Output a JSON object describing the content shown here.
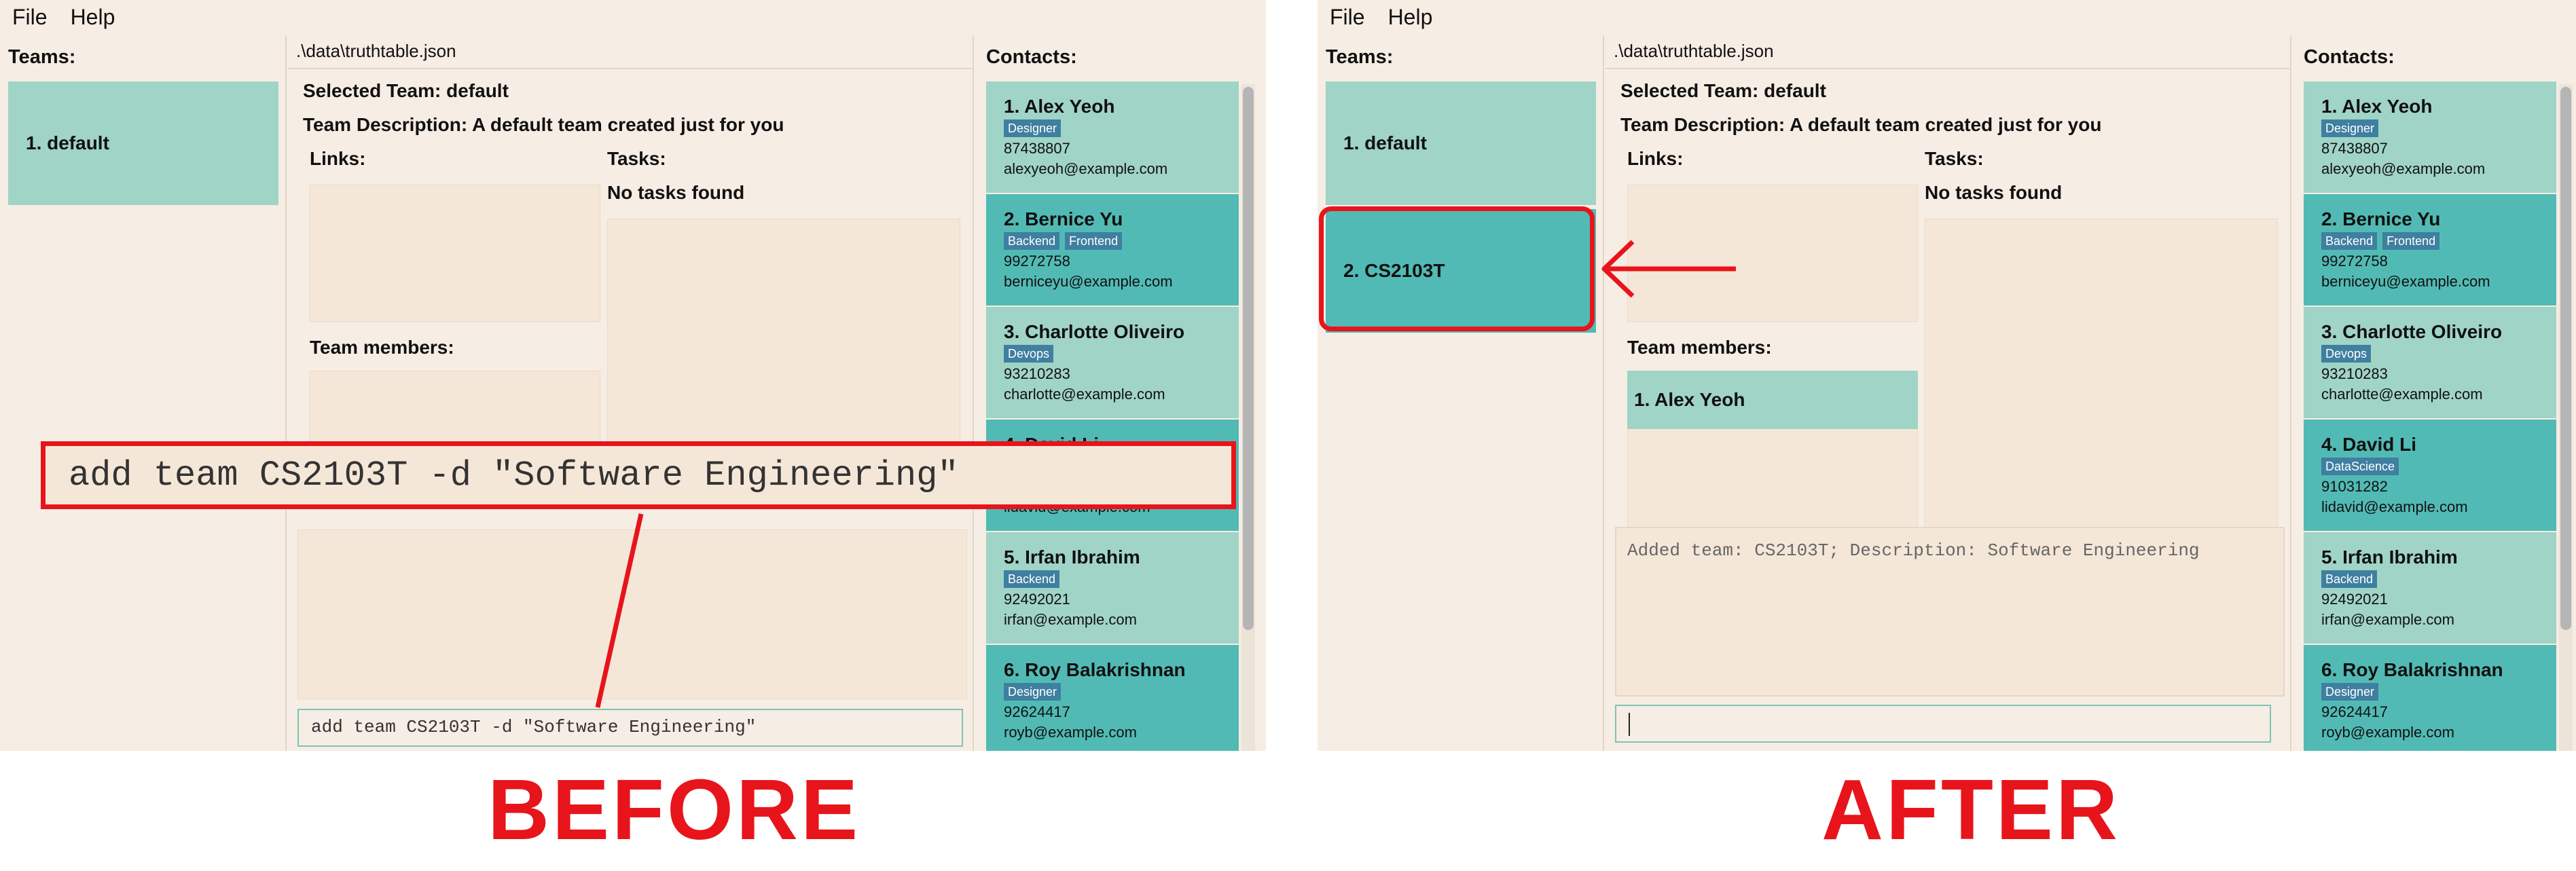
{
  "menu": {
    "file": "File",
    "help": "Help"
  },
  "teams_title": "Teams:",
  "contacts_title": "Contacts:",
  "file_path": ".\\data\\truthtable.json",
  "selected_team": "Selected Team: default",
  "team_description": "Team Description: A default team created just for you",
  "links_label": "Links:",
  "tasks_label": "Tasks:",
  "no_tasks": "No tasks found",
  "team_members_label": "Team members:",
  "before": {
    "teams": [
      "1. default"
    ],
    "command_input": "add team CS2103T -d \"Software Engineering\"",
    "overlay_command": "add team CS2103T -d \"Software Engineering\"",
    "label": "BEFORE"
  },
  "after": {
    "teams": [
      "1. default",
      "2. CS2103T"
    ],
    "member": "1. Alex Yeoh",
    "result": "Added team: CS2103T; Description: Software Engineering",
    "command_input": "",
    "label": "AFTER"
  },
  "contacts": [
    {
      "name": "1. Alex Yeoh",
      "tags": [
        "Designer"
      ],
      "phone": "87438807",
      "email": "alexyeoh@example.com"
    },
    {
      "name": "2. Bernice Yu",
      "tags": [
        "Backend",
        "Frontend"
      ],
      "phone": "99272758",
      "email": "berniceyu@example.com"
    },
    {
      "name": "3. Charlotte Oliveiro",
      "tags": [
        "Devops"
      ],
      "phone": "93210283",
      "email": "charlotte@example.com"
    },
    {
      "name": "4. David Li",
      "tags": [
        "DataScience"
      ],
      "phone": "91031282",
      "email": "lidavid@example.com"
    },
    {
      "name": "5. Irfan Ibrahim",
      "tags": [
        "Backend"
      ],
      "phone": "92492021",
      "email": "irfan@example.com"
    },
    {
      "name": "6. Roy Balakrishnan",
      "tags": [
        "Designer"
      ],
      "phone": "92624417",
      "email": "royb@example.com"
    }
  ],
  "colors": {
    "accent_red": "#e8141b",
    "card_light": "#a0d4c6",
    "card_dark": "#52bab5",
    "background": "#f6ede4",
    "tag": "#3f7fa0"
  }
}
